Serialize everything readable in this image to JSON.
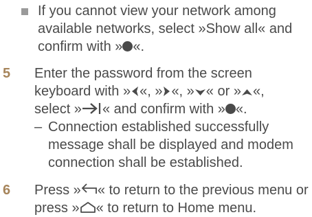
{
  "bullet": {
    "line1": "If you cannot view your network among",
    "line2": "available networks, select »Show all« and",
    "line3_pre": "confirm with »",
    "line3_post": "«."
  },
  "step5": {
    "number": "5",
    "line1": "Enter the password from the screen",
    "line2_a": "keyboard with »",
    "line2_b": "«, »",
    "line2_c": "«, »",
    "line2_d": "« or »",
    "line2_e": "«,",
    "line3_a": "select »",
    "line3_b": "« and confirm with »",
    "line3_c": "«.",
    "sub_dash": "–",
    "sub_line1": "Connection established successfully",
    "sub_line2": "message shall be displayed and modem",
    "sub_line3": "connection shall be established."
  },
  "step6": {
    "number": "6",
    "line1_a": "Press »",
    "line1_b": "« to return to the previous menu or",
    "line2_a": "press »",
    "line2_b": "« to return to Home menu."
  },
  "icons": {
    "ok_button": "filled-circle-icon",
    "left": "arrow-left-icon",
    "right": "arrow-right-icon",
    "down": "arrow-down-icon",
    "up": "arrow-up-icon",
    "enter": "arrow-to-bar-icon",
    "back": "back-arrow-icon",
    "home": "home-icon"
  },
  "colors": {
    "text": "#4a4a4a",
    "step_number": "#a6845a",
    "bullet": "#9a9a9a"
  }
}
